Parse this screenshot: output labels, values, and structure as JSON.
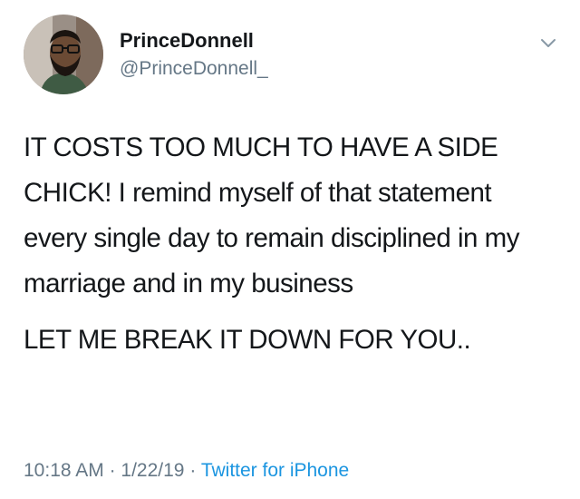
{
  "author": {
    "display_name": "PrinceDonnell",
    "handle": "@PrinceDonnell_"
  },
  "tweet": {
    "paragraph_1": "IT COSTS TOO MUCH TO HAVE A SIDE CHICK! I remind myself of that statement every single day to remain disciplined in my marriage and in my business",
    "paragraph_2": "LET ME BREAK IT DOWN FOR YOU.."
  },
  "meta": {
    "time": "10:18 AM",
    "date": "1/22/19",
    "separator": "·",
    "source": "Twitter for iPhone"
  },
  "icons": {
    "menu": "chevron-down-icon"
  },
  "colors": {
    "text": "#14171a",
    "secondary": "#657786",
    "link": "#1b95e0"
  }
}
